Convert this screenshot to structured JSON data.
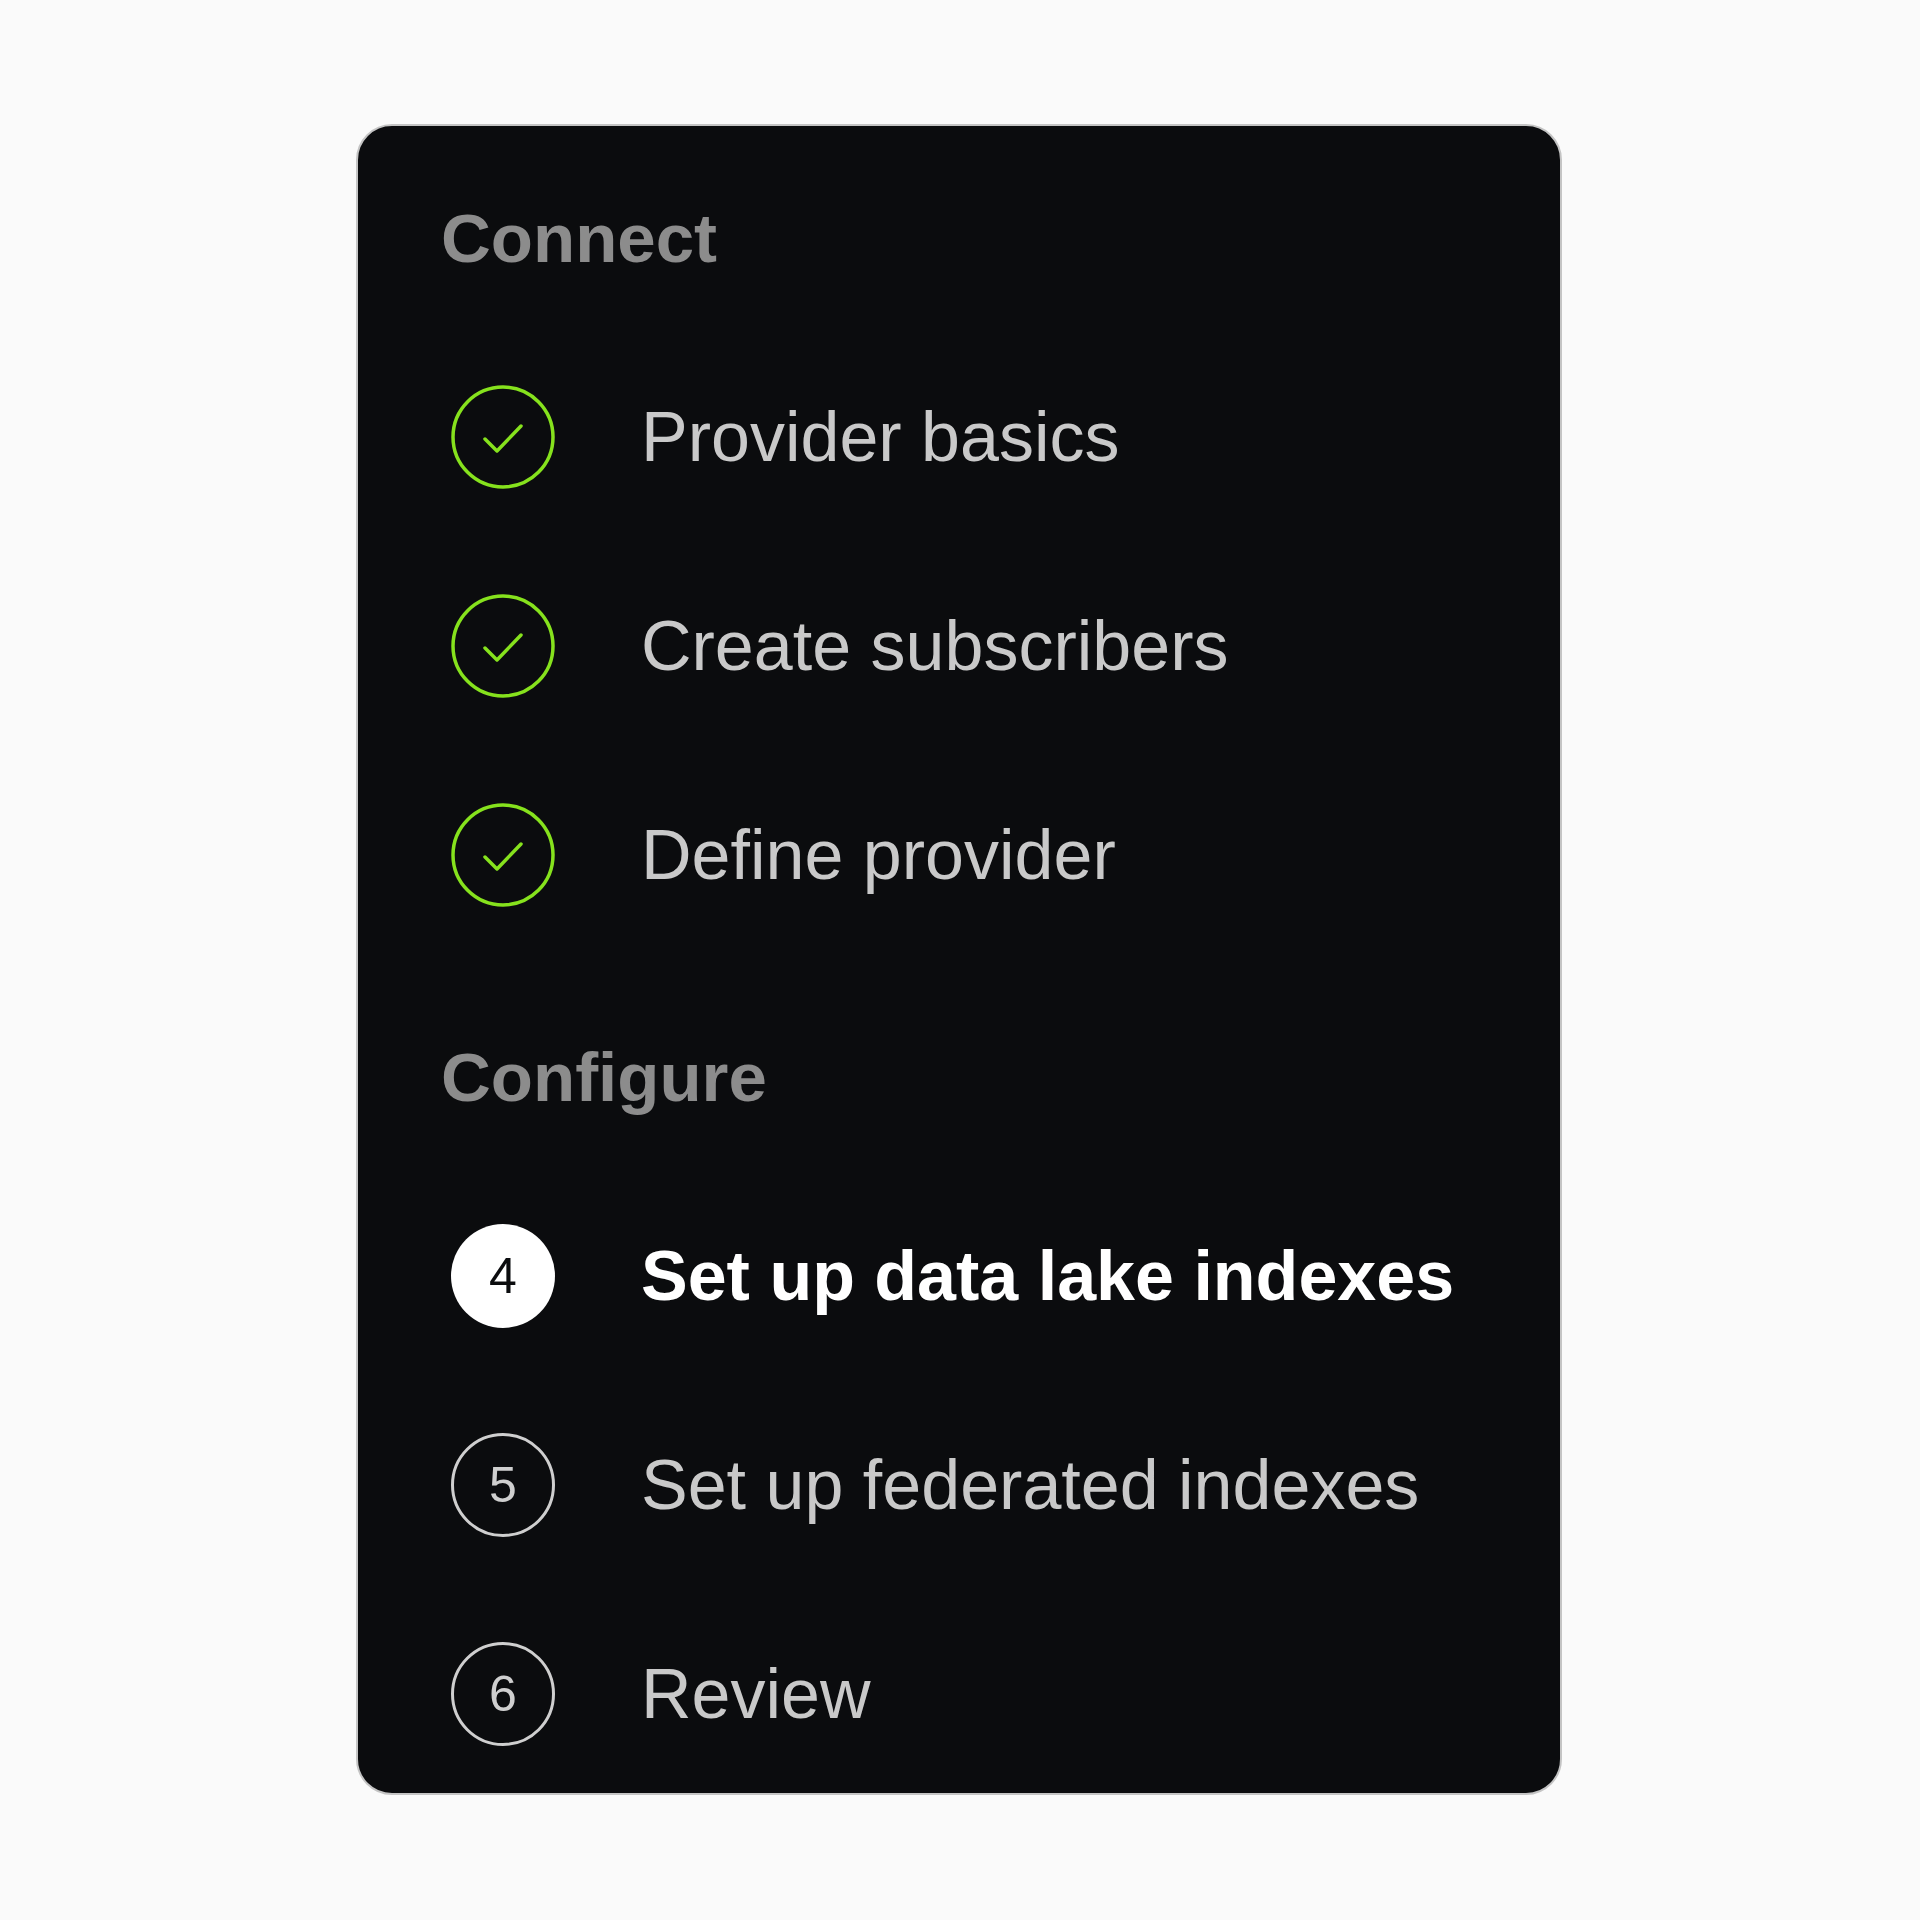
{
  "sections": [
    {
      "heading": "Connect",
      "steps": [
        {
          "label": "Provider basics",
          "completed": true,
          "selected": false
        },
        {
          "label": "Create subscribers",
          "completed": true,
          "selected": false
        },
        {
          "label": "Define provider",
          "completed": true,
          "selected": false
        }
      ]
    },
    {
      "heading": "Configure",
      "steps": [
        {
          "number": "4",
          "label": "Set up data lake indexes",
          "completed": false,
          "selected": true
        },
        {
          "number": "5",
          "label": "Set up federated indexes",
          "completed": false,
          "selected": false
        },
        {
          "number": "6",
          "label": "Review",
          "completed": false,
          "selected": false
        }
      ]
    }
  ]
}
